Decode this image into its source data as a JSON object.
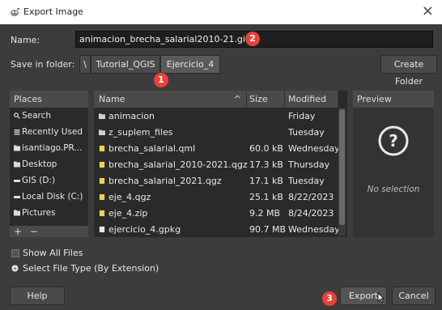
{
  "window": {
    "title": "Export Image",
    "close_symbol": "×"
  },
  "name": {
    "label": "Name:",
    "value": "animacion_brecha_salarial2010-21.gif"
  },
  "folder": {
    "label": "Save in folder:",
    "root": "\\",
    "crumbs": [
      "Tutorial_QGIS",
      "Ejercicio_4"
    ],
    "create_folder": "Create Folder"
  },
  "places": {
    "header": "Places",
    "items": [
      {
        "label": "Search",
        "icon": "search-icon"
      },
      {
        "label": "Recently Used",
        "icon": "recent-icon"
      },
      {
        "label": "isantiago.PR...",
        "icon": "folder-icon"
      },
      {
        "label": "Desktop",
        "icon": "folder-icon"
      },
      {
        "label": "GIS (D:)",
        "icon": "drive-icon"
      },
      {
        "label": "Local Disk (C:)",
        "icon": "drive-icon"
      },
      {
        "label": "Pictures",
        "icon": "folder-icon"
      }
    ],
    "add": "+",
    "remove": "−"
  },
  "files": {
    "columns": {
      "name": "Name",
      "size": "Size",
      "modified": "Modified"
    },
    "sort_indicator": "^",
    "rows": [
      {
        "name": "animacion",
        "size": "",
        "modified": "Friday",
        "icon": "folder-icon",
        "color": "#cfcfcf"
      },
      {
        "name": "z_suplem_files",
        "size": "",
        "modified": "Tuesday",
        "icon": "folder-icon",
        "color": "#cfcfcf"
      },
      {
        "name": "brecha_salarial.qml",
        "size": "60.0 kB",
        "modified": "Wednesday",
        "icon": "file-icon",
        "color": "#f0d34a"
      },
      {
        "name": "brecha_salarial_2010-2021.qgz",
        "size": "17.3 kB",
        "modified": "Thursday",
        "icon": "file-icon",
        "color": "#f0d34a"
      },
      {
        "name": "brecha_salarial_2021.qgz",
        "size": "17.1 kB",
        "modified": "Tuesday",
        "icon": "file-icon",
        "color": "#f0d34a"
      },
      {
        "name": "eje_4.qgz",
        "size": "25.1 kB",
        "modified": "8/22/2023",
        "icon": "file-icon",
        "color": "#f0d34a"
      },
      {
        "name": "eje_4.zip",
        "size": "9.2 MB",
        "modified": "8/24/2023",
        "icon": "file-icon",
        "color": "#f0d34a"
      },
      {
        "name": "ejercicio_4.gpkg",
        "size": "90.7 MB",
        "modified": "Wednesday",
        "icon": "file-icon",
        "color": "#e8e8e8"
      }
    ]
  },
  "preview": {
    "header": "Preview",
    "icon_symbol": "?",
    "message": "No selection"
  },
  "options": {
    "show_all_files": "Show All Files",
    "select_file_type": "Select File Type (By Extension)"
  },
  "buttons": {
    "help": "Help",
    "export": "Export",
    "cancel": "Cancel"
  },
  "annotations": {
    "one": "1",
    "two": "2",
    "three": "3"
  },
  "colors": {
    "badge": "#e8413a",
    "background": "#3c3c3c",
    "panel": "#2a2a2a"
  }
}
